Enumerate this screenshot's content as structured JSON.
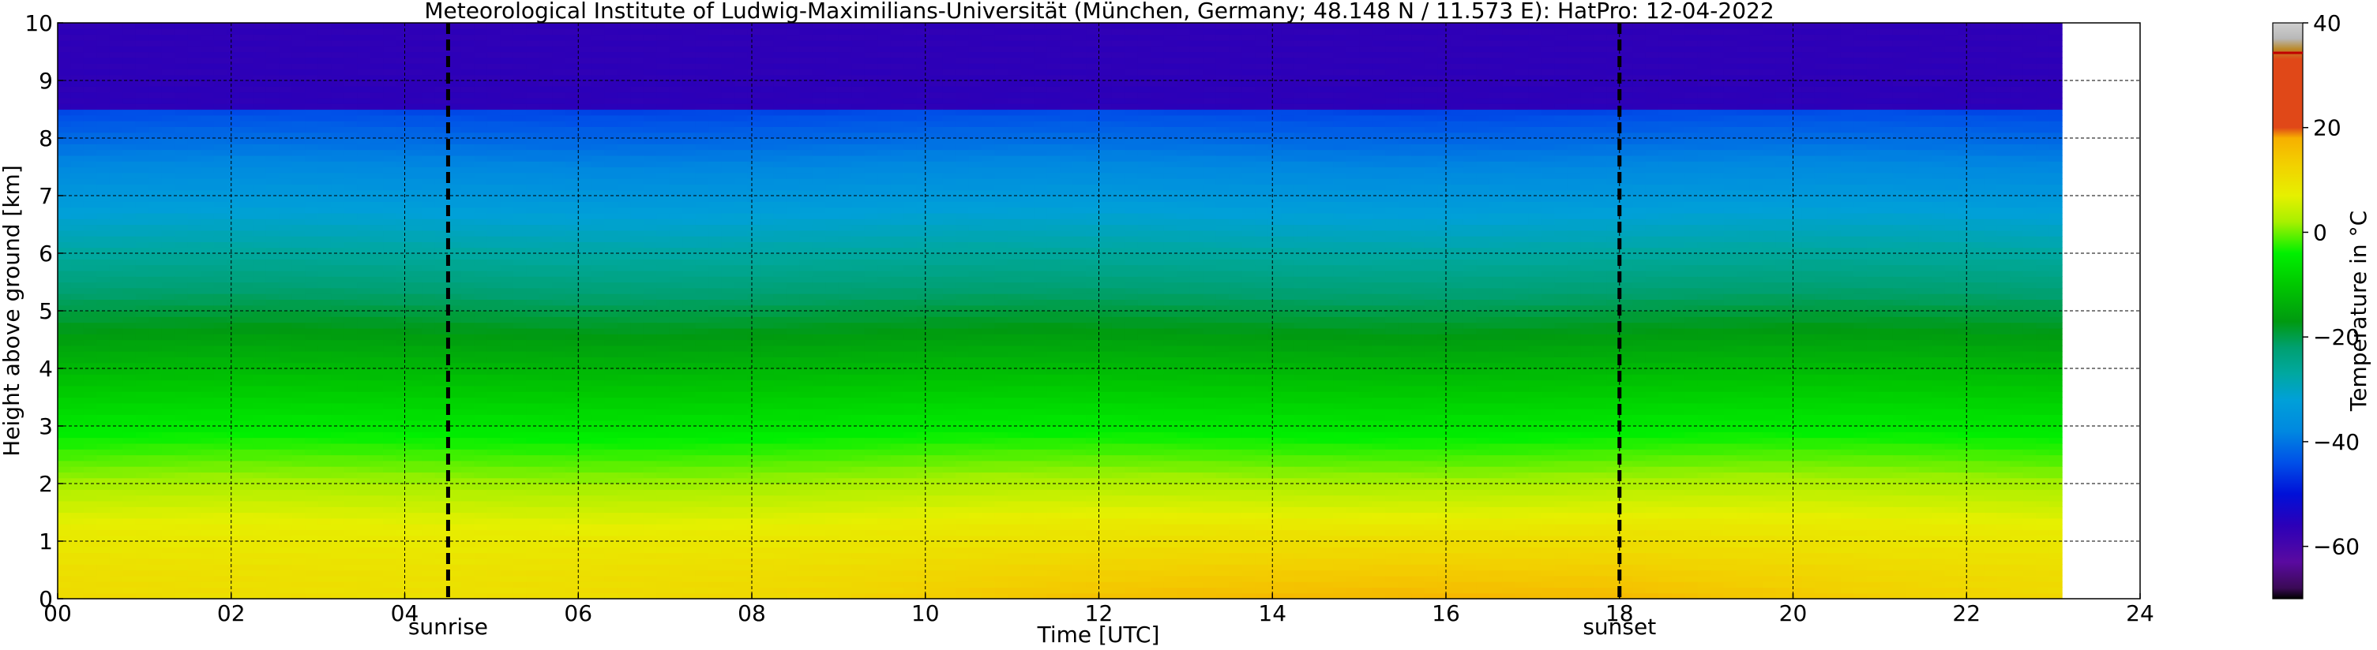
{
  "chart_data": {
    "type": "heatmap",
    "title": "Meteorological Institute of Ludwig-Maximilians-Universität (München, Germany; 48.148 N / 11.573 E):    HatPro: 12-04-2022",
    "xlabel": "Time [UTC]",
    "ylabel": "Height above ground [km]",
    "colorbar_label": "Temperature in °C",
    "xlim": [
      0,
      24
    ],
    "ylim": [
      0,
      10
    ],
    "clim": [
      -70,
      40
    ],
    "data_x_range": [
      0,
      23.1
    ],
    "x_ticks": [
      "00",
      "02",
      "04",
      "06",
      "08",
      "10",
      "12",
      "14",
      "16",
      "18",
      "20",
      "22",
      "24"
    ],
    "y_ticks": [
      "0",
      "1",
      "2",
      "3",
      "4",
      "5",
      "6",
      "7",
      "8",
      "9",
      "10"
    ],
    "colorbar_ticks": [
      "40",
      "20",
      "0",
      "−20",
      "−40",
      "−60"
    ],
    "grid": true,
    "events": [
      {
        "label": "sunrise",
        "time": 4.5
      },
      {
        "label": "sunset",
        "time": 18.0
      }
    ],
    "colormap": [
      {
        "t": -70,
        "color": "#000000"
      },
      {
        "t": -68,
        "color": "#3a0a55"
      },
      {
        "t": -63,
        "color": "#5a0aa0"
      },
      {
        "t": -56,
        "color": "#2c00b8"
      },
      {
        "t": -50,
        "color": "#0010d8"
      },
      {
        "t": -44,
        "color": "#0050e8"
      },
      {
        "t": -38,
        "color": "#0088e0"
      },
      {
        "t": -32,
        "color": "#00a0d8"
      },
      {
        "t": -27,
        "color": "#00a8a0"
      },
      {
        "t": -22,
        "color": "#00a070"
      },
      {
        "t": -17,
        "color": "#009a10"
      },
      {
        "t": -10,
        "color": "#00c800"
      },
      {
        "t": -4,
        "color": "#00f000"
      },
      {
        "t": 2,
        "color": "#a8f000"
      },
      {
        "t": 7,
        "color": "#e6f000"
      },
      {
        "t": 13,
        "color": "#f2d000"
      },
      {
        "t": 18,
        "color": "#f7b000"
      },
      {
        "t": 20,
        "color": "#e04818"
      },
      {
        "t": 33,
        "color": "#e04818"
      },
      {
        "t": 35,
        "color": "#bb8a2a"
      },
      {
        "t": 37,
        "color": "#b8b8b8"
      },
      {
        "t": 40,
        "color": "#d0d0d0"
      }
    ],
    "temperature_profile": {
      "heights_km": [
        0,
        0.5,
        1,
        1.5,
        2,
        2.5,
        3,
        3.5,
        4,
        4.5,
        5,
        5.5,
        6,
        6.5,
        7,
        7.5,
        8,
        8.5,
        9,
        9.5,
        10
      ],
      "times_utc": [
        0,
        4.5,
        9,
        11,
        13,
        15.5,
        18,
        21,
        23
      ],
      "surface_celsius": [
        11,
        10,
        12,
        14.5,
        16,
        17,
        16.5,
        13,
        11.5
      ]
    }
  }
}
